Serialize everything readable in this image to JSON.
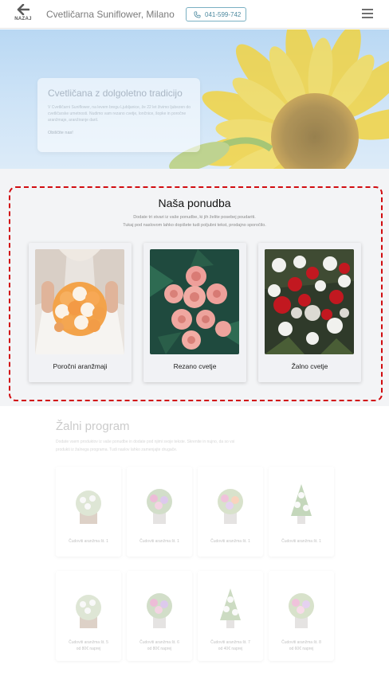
{
  "header": {
    "back_label": "NAZAJ",
    "shop_name": "Cvetličarna Suniflower, Milano",
    "phone": "041-599-742"
  },
  "hero": {
    "title": "Cvetličana z dolgoletno tradicijo",
    "text": "V Cvetličarni Suniflower, na levem bregu Ljubljanice, že 22 let živimo ljubezen do cvetličarske umetnosti. Nudimo vam rezano cvetje, lončnice, šopke in poročne aranžmaje, aranžiranje daril.",
    "link": "Obiščite nas!"
  },
  "offer": {
    "title": "Naša ponudba",
    "subtitle_line1": "Dodate tri stvari iz vaše ponudbe, ki jih želite posebej poudariti.",
    "subtitle_line2": "Tukaj pod naslovom lahko dopišete tudi poljubni tekst, prodajno sporočilo.",
    "cards": [
      {
        "label": "Poročni aranžmaji"
      },
      {
        "label": "Rezano cvetje"
      },
      {
        "label": "Žalno cvetje"
      }
    ]
  },
  "program": {
    "title": "Žalni program",
    "text": "Dodate vsem produktov iz vaše ponudbe in dodate pod njimi svoje tekste. Skrenite in nujno, da so vsi produkti iz žalnega programa. Tudi naslov lahko zamenjajte drugače.",
    "items": [
      {
        "name": "Čudoviti aranžma št. 1",
        "price": ""
      },
      {
        "name": "Čudoviti aranžma št. 1",
        "price": ""
      },
      {
        "name": "Čudoviti aranžma št. 1",
        "price": ""
      },
      {
        "name": "Čudoviti aranžma št. 1",
        "price": ""
      },
      {
        "name": "Čudoviti aranžma št. 5",
        "price": "od 80€ naprej"
      },
      {
        "name": "Čudoviti aranžma št. 6",
        "price": "od 80€ naprej"
      },
      {
        "name": "Čudoviti aranžma št. 7",
        "price": "od 40€ naprej"
      },
      {
        "name": "Čudoviti aranžma št. 8",
        "price": "od 60€ naprej"
      }
    ]
  },
  "colors": {
    "highlight_border": "#d10c10",
    "phone_accent": "#4d8aa0"
  }
}
